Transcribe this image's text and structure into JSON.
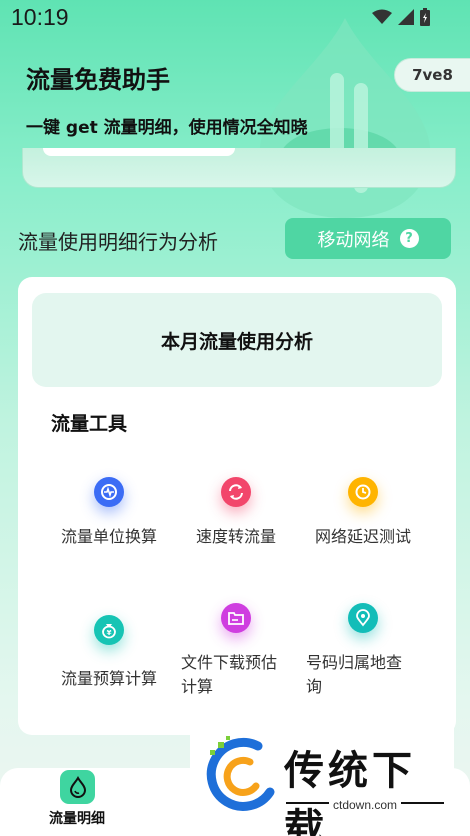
{
  "status_bar": {
    "time": "10:19",
    "icons": [
      "wifi-icon",
      "signal-icon",
      "battery-icon"
    ]
  },
  "header": {
    "title": "流量免费助手",
    "subtitle": "一键 get 流量明细，使用情况全知晓",
    "version": "7ve8"
  },
  "section": {
    "title": "流量使用明细行为分析",
    "network_button": "移动网络",
    "help_icon": "?"
  },
  "card": {
    "analysis_title": "本月流量使用分析",
    "tools_title": "流量工具",
    "tools": [
      {
        "label": "流量单位换算",
        "icon": "chart-bubble-icon",
        "color": "#3b6cf5"
      },
      {
        "label": "速度转流量",
        "icon": "refresh-icon",
        "color": "#f2466b"
      },
      {
        "label": "网络延迟测试",
        "icon": "clock-history-icon",
        "color": "#ffb400"
      },
      {
        "label": "流量预算计算",
        "icon": "money-bag-icon",
        "color": "#16c4b4"
      },
      {
        "label": "文件下载预估计算",
        "icon": "folder-icon",
        "color": "#cf3ee0"
      },
      {
        "label": "号码归属地查询",
        "icon": "location-pin-icon",
        "color": "#12bdb8"
      }
    ]
  },
  "bottom_nav": {
    "label": "流量明细",
    "icon": "drop-icon"
  },
  "watermark": {
    "text": "传统下载",
    "domain": "ctdown.com"
  },
  "colors": {
    "accent": "#4fd6a3",
    "background": "#8aeecb"
  }
}
